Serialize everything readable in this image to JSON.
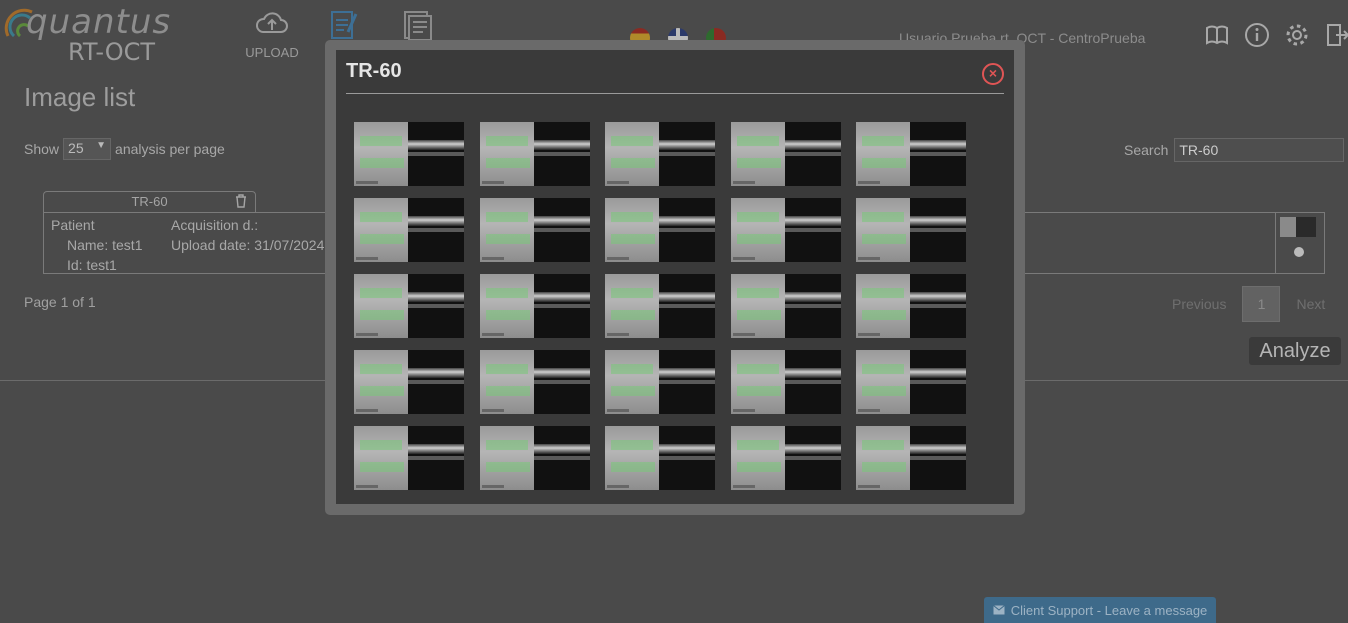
{
  "app": {
    "logo_word1": "quantus",
    "logo_word2": "RT-OCT"
  },
  "nav": [
    {
      "label": "UPLOAD",
      "icon": "cloud-upload-icon"
    },
    {
      "label": "",
      "icon": "edit-document-icon"
    },
    {
      "label": "",
      "icon": "report-document-icon"
    }
  ],
  "languages": [
    {
      "icon": "spain-flag-icon",
      "color": "#c0392b"
    },
    {
      "icon": "uk-flag-icon",
      "color": "#2c3e7a"
    },
    {
      "icon": "portugal-flag-icon",
      "color": "#2e7d32"
    }
  ],
  "user": {
    "text": "Usuario Prueba rt_OCT - CentroPrueba"
  },
  "top_icons": [
    "manual-book-icon",
    "info-icon",
    "settings-gear-icon",
    "logout-icon"
  ],
  "page": {
    "title": "Image list"
  },
  "list_controls": {
    "show_label": "Show",
    "per_page_value": "25",
    "per_page_suffix": "analysis per page",
    "search_label": "Search",
    "search_value": "TR-60"
  },
  "card": {
    "tab_label": "TR-60",
    "patient_label": "Patient",
    "name_text": "Name: test1",
    "id_text": "Id: test1",
    "acq_label": "Acquisition d.:",
    "upload_text": "Upload date: 31/07/2024"
  },
  "pagination": {
    "info": "Page 1 of 1",
    "previous": "Previous",
    "current": "1",
    "next": "Next"
  },
  "analyze_button": "Analyze",
  "support": {
    "label": "Client Support - Leave a message"
  },
  "modal": {
    "title": "TR-60",
    "image_count": 25
  },
  "colors": {
    "accent_close": "#e05555",
    "support_bg": "#3e6a8a"
  }
}
